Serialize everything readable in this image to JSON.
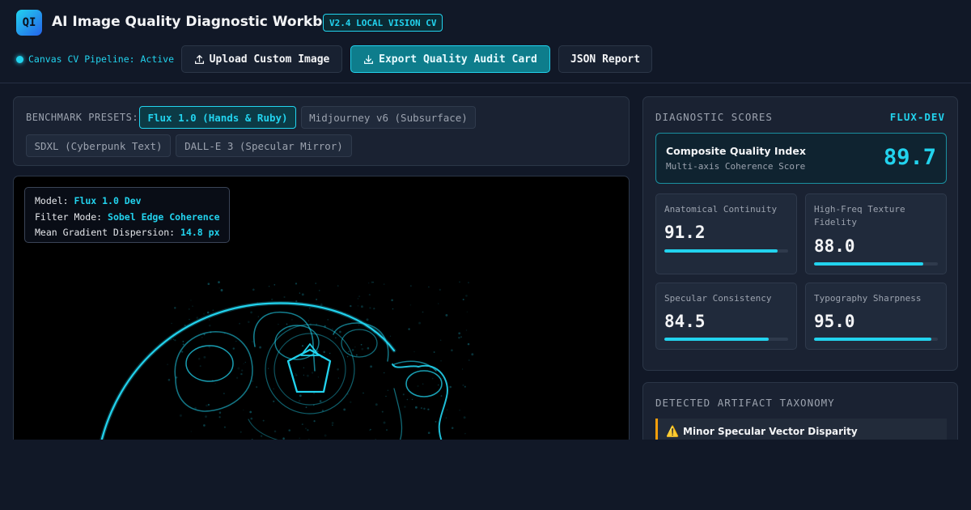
{
  "header": {
    "logo": "QI",
    "title": "AI Image Quality Diagnostic Workbench",
    "version_badge": "V2.4 LOCAL VISION CV",
    "status": "Canvas CV Pipeline: Active",
    "buttons": {
      "upload": "Upload Custom Image",
      "export": "Export Quality Audit Card",
      "json": "JSON Report"
    },
    "icons": {
      "upload": "upload-icon",
      "export": "download-icon"
    },
    "accent_color": "#22d3ee"
  },
  "presets": {
    "label": "BENCHMARK PRESETS:",
    "items": [
      {
        "label": "Flux 1.0 (Hands & Ruby)",
        "active": true
      },
      {
        "label": "Midjourney v6 (Subsurface)",
        "active": false
      },
      {
        "label": "SDXL (Cyberpunk Text)",
        "active": false
      },
      {
        "label": "DALL-E 3 (Specular Mirror)",
        "active": false
      }
    ]
  },
  "canvas": {
    "overlay": {
      "model_label": "Model:",
      "model_value": "Flux 1.0 Dev",
      "filter_label": "Filter Mode:",
      "filter_value": "Sobel Edge Coherence",
      "gradient_label": "Mean Gradient Dispersion:",
      "gradient_value": "14.8 px"
    }
  },
  "scores": {
    "title": "DIAGNOSTIC SCORES",
    "model_tag": "FLUX-DEV",
    "composite": {
      "title": "Composite Quality Index",
      "subtitle": "Multi-axis Coherence Score",
      "value": "89.7"
    },
    "metrics": [
      {
        "name": "Anatomical Continuity",
        "value": "91.2",
        "level": 0.912
      },
      {
        "name": "High-Freq Texture Fidelity",
        "value": "88.0",
        "level": 0.88
      },
      {
        "name": "Specular Consistency",
        "value": "84.5",
        "level": 0.845
      },
      {
        "name": "Typography Sharpness",
        "value": "95.0",
        "level": 0.95
      }
    ]
  },
  "taxonomy": {
    "title": "DETECTED ARTIFACT TAXONOMY",
    "items": [
      {
        "icon": "warning-icon",
        "glyph": "⚠️",
        "title": "Minor Specular Vector Disparity",
        "color": "#f59e0b"
      }
    ]
  }
}
